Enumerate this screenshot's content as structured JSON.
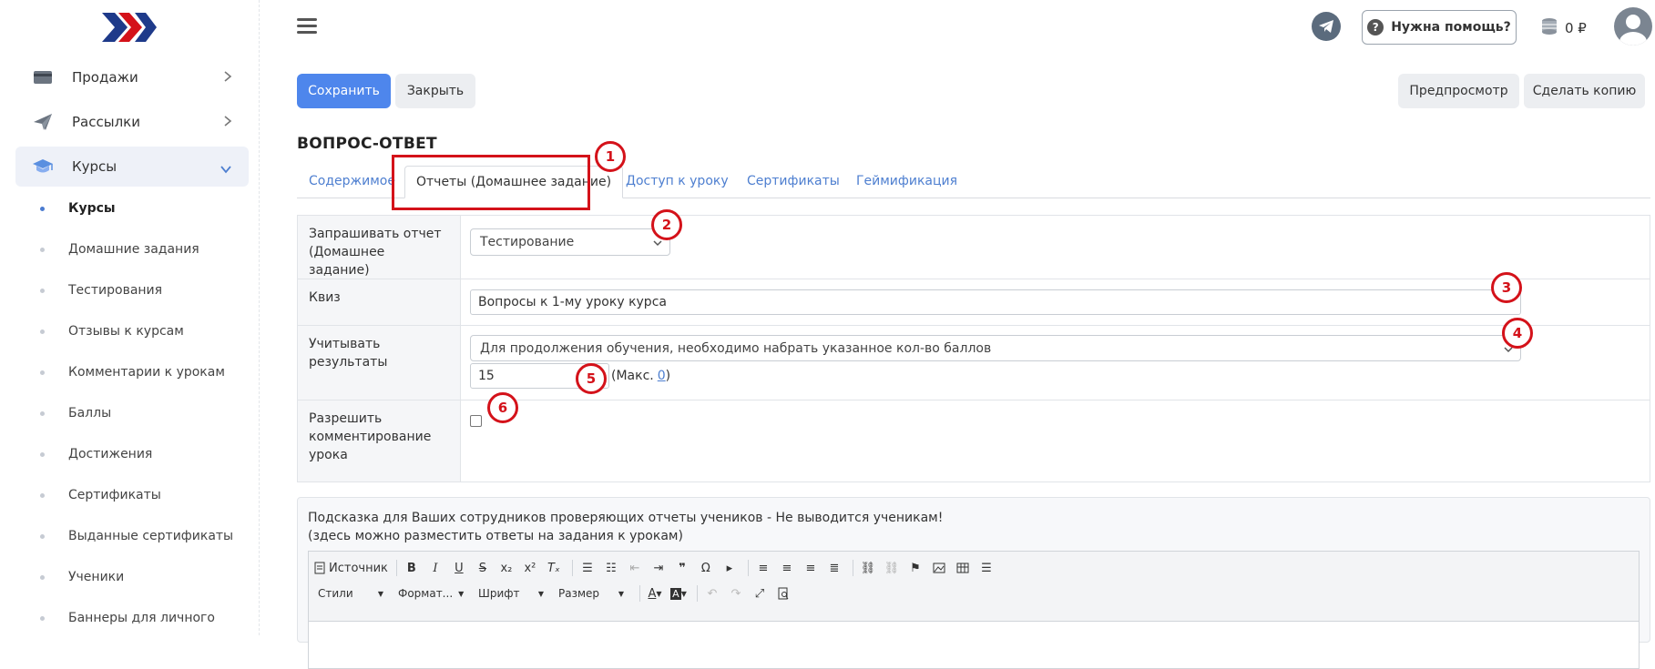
{
  "sidebar": {
    "items": [
      {
        "label": "Продажи",
        "icon": "wallet-icon"
      },
      {
        "label": "Рассылки",
        "icon": "paper-plane-icon"
      },
      {
        "label": "Курсы",
        "icon": "graduation-cap-icon"
      }
    ],
    "subitems": [
      "Курсы",
      "Домашние задания",
      "Тестирования",
      "Отзывы к курсам",
      "Комментарии к урокам",
      "Баллы",
      "Достижения",
      "Сертификаты",
      "Выданные сертификаты",
      "Ученики",
      "Баннеры для личного"
    ]
  },
  "topbar": {
    "help_label": "Нужна помощь?",
    "balance": "0 ₽"
  },
  "actions": {
    "save": "Сохранить",
    "close": "Закрыть",
    "preview": "Предпросмотр",
    "copy": "Сделать копию"
  },
  "page_title": "ВОПРОС-ОТВЕТ",
  "tabs": [
    "Содержимое",
    "Отчеты (Домашнее задание)",
    "Доступ к уроку",
    "Сертификаты",
    "Геймификация"
  ],
  "form": {
    "report_label": "Запрашивать отчет (Домашнее задание)",
    "report_value": "Тестирование",
    "quiz_label": "Квиз",
    "quiz_value": "Вопросы к 1-му уроку курса",
    "results_label": "Учитывать результаты",
    "results_value": "Для продолжения обучения, необходимо набрать указанное кол-во баллов",
    "score_value": "15",
    "max_prefix": "(Макс.",
    "max_value": "0",
    "max_suffix": ")",
    "comments_label": "Разрешить комментирование урока"
  },
  "editor": {
    "hint_line1": "Подсказка для Ваших сотрудников проверяющих отчеты учеников - Не выводится ученикам!",
    "hint_line2": "(здесь можно разместить ответы на задания к урокам)",
    "source_label": "Источник",
    "styles_label": "Стили",
    "format_label": "Формат...",
    "font_label": "Шрифт",
    "size_label": "Размер"
  },
  "annotations": [
    "1",
    "2",
    "3",
    "4",
    "5",
    "6"
  ],
  "colors": {
    "primary": "#4e86ec",
    "annotation": "#d4121a",
    "link": "#4e7fd0"
  }
}
